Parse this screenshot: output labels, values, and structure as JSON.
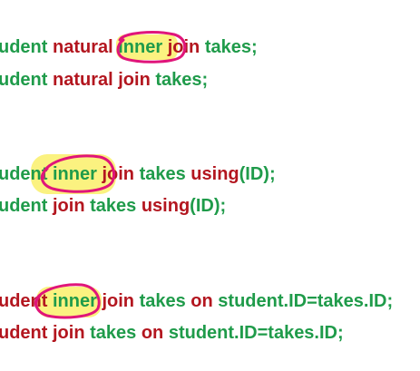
{
  "colors": {
    "keyword": "#b3161f",
    "identifier": "#1f9b4a",
    "highlight": "#fbf280",
    "pen": "#e0157a"
  },
  "group1": {
    "line1": {
      "a": "udent ",
      "b": "natural ",
      "c": "inner",
      "d": " join ",
      "e": "takes;"
    },
    "line2": {
      "a": "udent ",
      "b": "natural join ",
      "c": "takes;"
    }
  },
  "group2": {
    "line1": {
      "a": "udent ",
      "b": "inner",
      "c": " join ",
      "d": "takes ",
      "e": "using",
      "f": "(ID);"
    },
    "line2": {
      "a": "udent ",
      "b": "join ",
      "c": "takes ",
      "d": "using",
      "e": "(ID);"
    }
  },
  "group3": {
    "line1": {
      "a": "udent ",
      "b": "inner",
      "c": " join ",
      "d": "takes ",
      "e": "on ",
      "f": "student.ID=takes.ID;"
    },
    "line2": {
      "a": "udent ",
      "b": "join ",
      "c": "takes ",
      "d": "on ",
      "e": "student.ID=takes.ID;"
    }
  }
}
